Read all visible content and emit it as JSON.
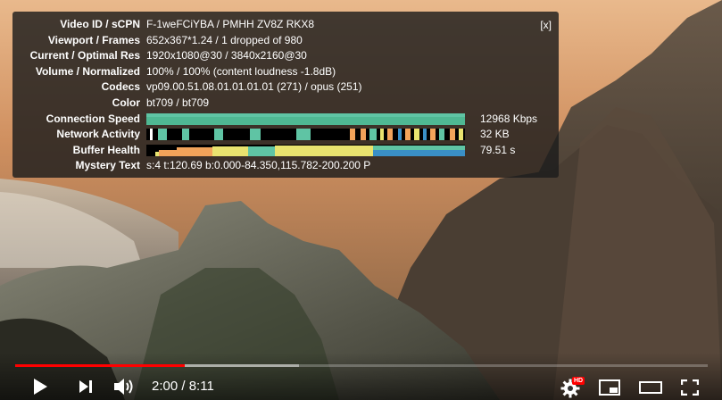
{
  "stats": {
    "close_label": "[x]",
    "rows": [
      {
        "label": "Video ID / sCPN",
        "value": "F-1weFCiYBA / PMHH ZV8Z RKX8"
      },
      {
        "label": "Viewport / Frames",
        "value": "652x367*1.24 / 1 dropped of 980"
      },
      {
        "label": "Current / Optimal Res",
        "value": "1920x1080@30 / 3840x2160@30"
      },
      {
        "label": "Volume / Normalized",
        "value": "100% / 100% (content loudness -1.8dB)"
      },
      {
        "label": "Codecs",
        "value": "vp09.00.51.08.01.01.01.01 (271) / opus (251)"
      },
      {
        "label": "Color",
        "value": "bt709 / bt709"
      }
    ],
    "connection_speed": {
      "label": "Connection Speed",
      "value": "12968 Kbps"
    },
    "network_activity": {
      "label": "Network Activity",
      "value": "32 KB"
    },
    "buffer_health": {
      "label": "Buffer Health",
      "value": "79.51 s"
    },
    "mystery_text": {
      "label": "Mystery Text",
      "value": "s:4 t:120.69 b:0.000-84.350,115.782-200.200 P"
    },
    "colors": {
      "graph_teal": "#5fc4a4",
      "graph_blue": "#3a8fc6",
      "graph_orange": "#f2a35a",
      "graph_yellow": "#e9e36f"
    }
  },
  "player": {
    "time_current": "2:00",
    "time_separator": " / ",
    "time_total": "8:11",
    "played_fraction": 0.245,
    "buffered_fraction": 0.41,
    "hd_badge": "HD",
    "accent": "#ff0000"
  }
}
